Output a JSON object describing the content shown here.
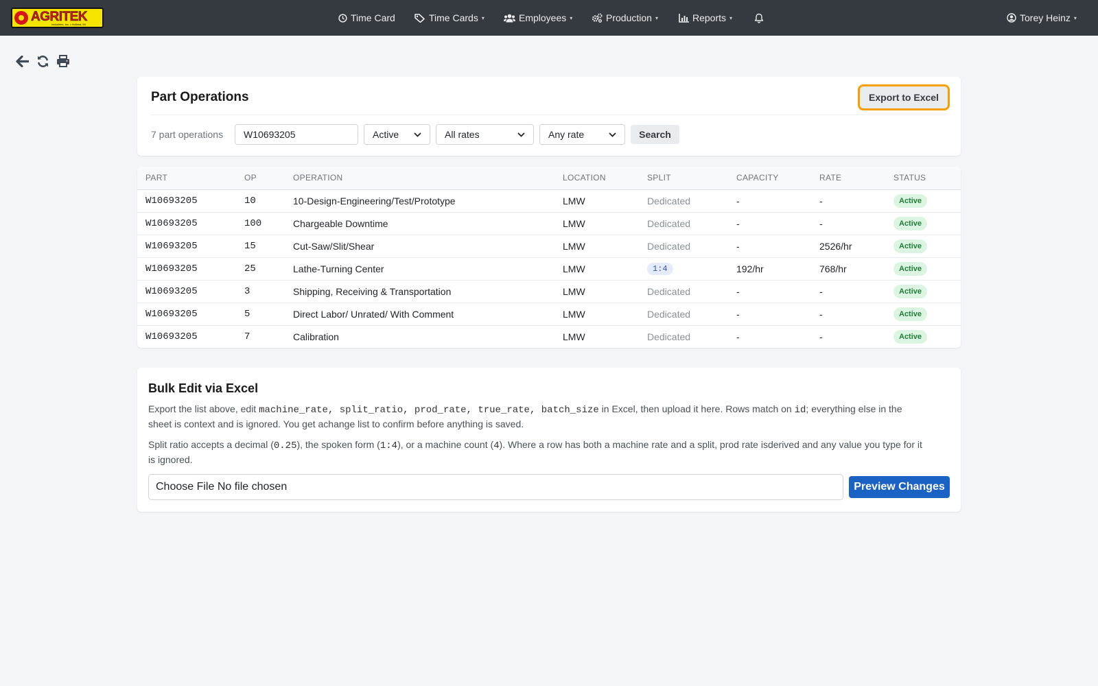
{
  "app": {
    "logo_text": "AGRITEK",
    "logo_sub": "Industries, Inc. • Holland, MI"
  },
  "nav": {
    "time_card": "Time Card",
    "time_cards": "Time Cards",
    "employees": "Employees",
    "production": "Production",
    "reports": "Reports",
    "user": "Torey Heinz",
    "caret": "▾"
  },
  "header": {
    "title": "Part Operations",
    "export_label": "Export to Excel",
    "count_text": "7 part operations",
    "search_value": "W10693205",
    "status_filter": "Active",
    "rates_filter": "All rates",
    "rate_filter": "Any rate",
    "search_label": "Search"
  },
  "table": {
    "columns": [
      "PART",
      "OP",
      "OPERATION",
      "LOCATION",
      "SPLIT",
      "CAPACITY",
      "RATE",
      "STATUS"
    ],
    "rows": [
      {
        "part": "W10693205",
        "op": "10",
        "operation": "10-Design-Engineering/Test/Prototype",
        "location": "LMW",
        "split": "Dedicated",
        "capacity": "-",
        "rate": "-",
        "status": "Active"
      },
      {
        "part": "W10693205",
        "op": "100",
        "operation": "Chargeable Downtime",
        "location": "LMW",
        "split": "Dedicated",
        "capacity": "-",
        "rate": "-",
        "status": "Active"
      },
      {
        "part": "W10693205",
        "op": "15",
        "operation": "Cut-Saw/Slit/Shear",
        "location": "LMW",
        "split": "Dedicated",
        "capacity": "-",
        "rate": "2526/hr",
        "status": "Active"
      },
      {
        "part": "W10693205",
        "op": "25",
        "operation": "Lathe-Turning Center",
        "location": "LMW",
        "split": "1:4",
        "capacity": "192/hr",
        "rate": "768/hr",
        "status": "Active"
      },
      {
        "part": "W10693205",
        "op": "3",
        "operation": "Shipping, Receiving & Transportation",
        "location": "LMW",
        "split": "Dedicated",
        "capacity": "-",
        "rate": "-",
        "status": "Active"
      },
      {
        "part": "W10693205",
        "op": "5",
        "operation": "Direct Labor/ Unrated/ With Comment",
        "location": "LMW",
        "split": "Dedicated",
        "capacity": "-",
        "rate": "-",
        "status": "Active"
      },
      {
        "part": "W10693205",
        "op": "7",
        "operation": "Calibration",
        "location": "LMW",
        "split": "Dedicated",
        "capacity": "-",
        "rate": "-",
        "status": "Active"
      }
    ]
  },
  "bulk": {
    "title": "Bulk Edit via Excel",
    "p1_a": "Export the list above, edit ",
    "p1_code1": "machine_rate, split_ratio, prod_rate, true_rate, batch_size",
    "p1_b": " in Excel, then upload it here. Rows match on ",
    "p1_code2": "id",
    "p1_c": "; everything else in the sheet is context and is ignored. You get achange list to confirm before anything is saved.",
    "p2_a": "Split ratio accepts a decimal (",
    "p2_code1": "0.25",
    "p2_b": "), the spoken form (",
    "p2_code2": "1:4",
    "p2_c": "), or a machine count (",
    "p2_code3": "4",
    "p2_d": "). Where a row has both a machine rate and a split, prod rate isderived and any value you type for it is ignored.",
    "file_label": "Choose File No file chosen",
    "preview_label": "Preview Changes"
  },
  "colors": {
    "navbar": "#343a40",
    "export_outline": "#f59f00",
    "primary": "#1a62c4",
    "status_green": "#1e7e34"
  },
  "icons": [
    "back-arrow-icon",
    "refresh-icon",
    "print-icon",
    "clock-icon",
    "tag-icon",
    "users-icon",
    "gears-icon",
    "chart-icon",
    "bell-icon",
    "user-circle-icon"
  ]
}
